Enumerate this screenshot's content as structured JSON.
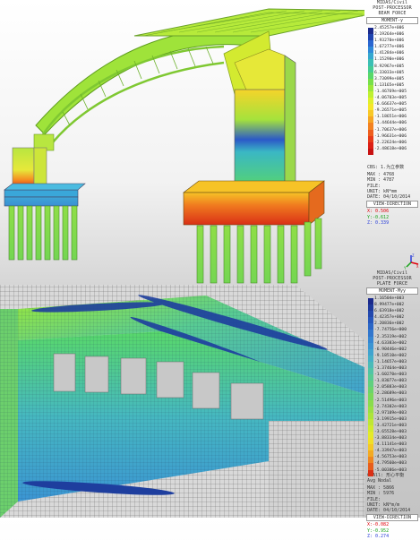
{
  "panel_top": {
    "app": "MIDAS/Civil",
    "module": "POST-PROCESSOR",
    "result_type": "BEAM FORCE",
    "component": "MOMENT-y",
    "legend_values": [
      "2.45257e+006",
      "2.19264e+006",
      "1.93270e+006",
      "1.67277e+006",
      "1.41284e+006",
      "1.15290e+006",
      "8.92967e+005",
      "6.33033e+005",
      "3.73099e+005",
      "1.13165e+005",
      "-1.46769e+005",
      "-4.06703e+005",
      "-6.66637e+005",
      "-9.26571e+005",
      "-1.18651e+006",
      "-1.44644e+006",
      "-1.70637e+006",
      "-1.96631e+006",
      "-2.22624e+006",
      "-2.48618e+006"
    ],
    "legend_colors": [
      "#1b2a8c",
      "#1f44b0",
      "#2a66d0",
      "#2f89d8",
      "#35a7cf",
      "#3bbfb4",
      "#45cc93",
      "#58d86a",
      "#78e04a",
      "#9be83a",
      "#bff031",
      "#dff02c",
      "#f6e62a",
      "#f8c827",
      "#f6a524",
      "#f38220",
      "#ee5d1c",
      "#e73a18",
      "#dc1f15",
      "#c81212"
    ],
    "cbs_label": "CBS: 1.为立参数",
    "max": "MAX : 4768",
    "min": "MIN : 4787",
    "file": "FILE:",
    "unit": "UNIT: kN*mm",
    "date": "DATE: 04/10/2014",
    "view_direction": "VIEW-DIRECTION",
    "x": "X: 0.506",
    "y": "Y:-0.612",
    "z": "Z: 0.339"
  },
  "panel_bottom": {
    "app": "MIDAS/Civil",
    "module": "POST-PROCESSOR",
    "result_type": "PLATE FORCE",
    "component": "MOMENT-Myy",
    "legend_values": [
      "1.16504e+003",
      "8.99477e+002",
      "6.63918e+002",
      "4.42357e+002",
      "2.20836e+002",
      "-7.74756e+000",
      "-2.35319e+002",
      "-4.63383e+002",
      "-6.90446e+002",
      "-9.18510e+002",
      "-1.14657e+003",
      "-1.37464e+003",
      "-1.60270e+003",
      "-1.83077e+003",
      "-2.05883e+003",
      "-2.28689e+003",
      "-2.51496e+003",
      "-2.74302e+003",
      "-2.97109e+003",
      "-3.19915e+003",
      "-3.42721e+003",
      "-3.65528e+003",
      "-3.88334e+003",
      "-4.11141e+003",
      "-4.33947e+003",
      "-4.56753e+003",
      "-4.79560e+003",
      "-5.00386e+003"
    ],
    "legend_colors": [
      "#1b2a8c",
      "#1e3a9c",
      "#2348ad",
      "#2656bb",
      "#2b66c6",
      "#3176cd",
      "#3686d2",
      "#3b95d3",
      "#41a3cf",
      "#46b0c6",
      "#4bbbb8",
      "#51c4a6",
      "#58cb93",
      "#61d07f",
      "#6cd46b",
      "#7ad85a",
      "#8adc4d",
      "#9be043",
      "#ade43b",
      "#bfe734",
      "#d2ea2e",
      "#e4ea29",
      "#f1df27",
      "#f5c825",
      "#f3aa22",
      "#ef861f",
      "#e85e1b",
      "#d93016"
    ],
    "cbs_label": "CBAll: 形心平衡",
    "sub_label": "Avg Nodal",
    "max": "MAX : 5866",
    "min": "MIN : 5976",
    "file": "FILE:",
    "unit": "UNIT: kN*m/m",
    "date": "DATE: 04/10/2014",
    "view_direction": "VIEW-DIRECTION",
    "x": "X:-0.082",
    "y": "Y:-0.952",
    "z": "Z: 0.274"
  },
  "axis_icon": {
    "x": "X",
    "y": "Y",
    "z": "Z"
  },
  "colors": {
    "accent_red": "#e0000a",
    "accent_green": "#17a31a",
    "accent_blue": "#2a3ed9"
  }
}
